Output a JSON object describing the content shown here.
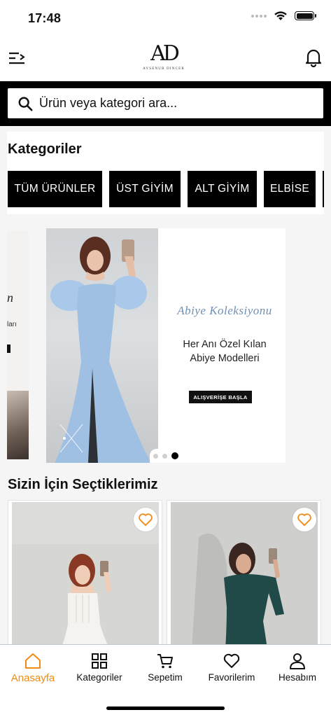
{
  "status_bar": {
    "time": "17:48"
  },
  "app_bar": {
    "logo_text": "AD",
    "logo_subtitle": "AYSENUR DINCER"
  },
  "search": {
    "placeholder": "Ürün veya kategori ara..."
  },
  "categories": {
    "title": "Kategoriler",
    "chips": [
      "TÜM ÜRÜNLER",
      "ÜST GİYİM",
      "ALT GİYİM",
      "ELBİSE"
    ]
  },
  "banner": {
    "prev_slide_text1": "n",
    "prev_slide_text2": "ları",
    "script_title": "Abiye Koleksiyonu",
    "headline_line1": "Her Anı Özel Kılan",
    "headline_line2": "Abiye Modelleri",
    "cta": "ALIŞVERİŞE BAŞLA",
    "slide_count": 3,
    "active_slide": 3
  },
  "recommendations": {
    "title": "Sizin İçin Seçtiklerimiz",
    "products": [
      {
        "image": "white-corset-dress-photo",
        "favorite_icon": "heart-outline-icon"
      },
      {
        "image": "green-long-sleeve-dress-photo",
        "favorite_icon": "heart-outline-icon"
      }
    ]
  },
  "bottom_nav": {
    "items": [
      {
        "label": "Anasayfa",
        "icon": "home-icon",
        "active": true
      },
      {
        "label": "Kategoriler",
        "icon": "grid-icon",
        "active": false
      },
      {
        "label": "Sepetim",
        "icon": "cart-icon",
        "active": false
      },
      {
        "label": "Favorilerim",
        "icon": "heart-icon",
        "active": false
      },
      {
        "label": "Hesabım",
        "icon": "user-icon",
        "active": false
      }
    ]
  },
  "colors": {
    "accent": "#f08c13",
    "primary": "#000000",
    "banner_script": "#6f8fb3"
  }
}
